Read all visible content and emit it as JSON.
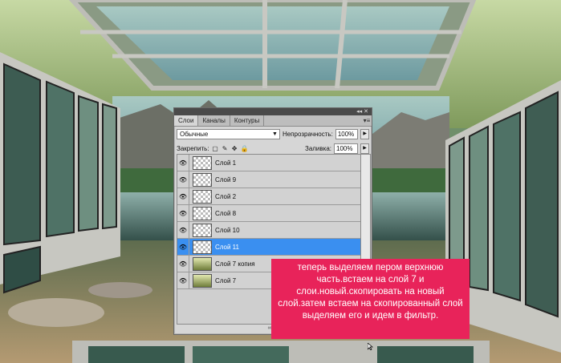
{
  "panel": {
    "tabs": [
      "Слои",
      "Каналы",
      "Контуры"
    ],
    "blend_mode": "Обычные",
    "opacity_label": "Непрозрачность:",
    "opacity_value": "100%",
    "lock_label": "Закрепить:",
    "fill_label": "Заливка:",
    "fill_value": "100%",
    "layers": [
      {
        "name": "Слой 1",
        "thumb": "transparent",
        "selected": false
      },
      {
        "name": "Слой 9",
        "thumb": "transparent",
        "selected": false
      },
      {
        "name": "Слой 2",
        "thumb": "transparent",
        "selected": false
      },
      {
        "name": "Слой 8",
        "thumb": "transparent",
        "selected": false
      },
      {
        "name": "Слой 10",
        "thumb": "transparent",
        "selected": false
      },
      {
        "name": "Слой 11",
        "thumb": "transparent",
        "selected": true
      },
      {
        "name": "Слой 7 копия",
        "thumb": "green",
        "selected": false
      },
      {
        "name": "Слой 7",
        "thumb": "green",
        "selected": false
      }
    ]
  },
  "note": {
    "text": "теперь выделяем пером верхнюю часть.встаем на слой 7 и слои.новый.скопировать на новый слой.затем встаем на скопированный слой выделяем его и идем в фильтр."
  },
  "colors": {
    "selection": "#3a8ff0",
    "note_bg": "#e8235a"
  }
}
